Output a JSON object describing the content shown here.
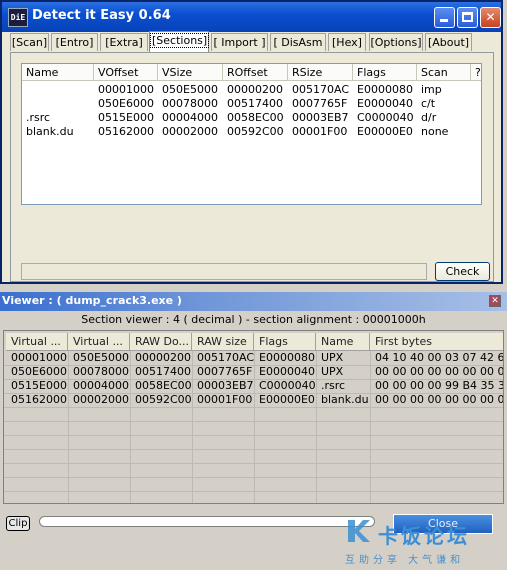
{
  "die": {
    "title": "Detect it Easy 0.64",
    "icon_label": "DiE",
    "tabs": [
      {
        "label": "[Scan]"
      },
      {
        "label": "[Entro]"
      },
      {
        "label": "[Extra]"
      },
      {
        "label": "[Sections]",
        "active": true
      },
      {
        "label": "[ Import ]"
      },
      {
        "label": "[ DisAsm ]"
      },
      {
        "label": "[Hex]"
      },
      {
        "label": "[Options]"
      },
      {
        "label": "[About]"
      }
    ],
    "sections": {
      "columns": [
        "Name",
        "VOffset",
        "VSize",
        "ROffset",
        "RSize",
        "Flags",
        "Scan",
        "?"
      ],
      "rows": [
        [
          "",
          "00001000",
          "050E5000",
          "00000200",
          "005170AC",
          "E0000080",
          "imp"
        ],
        [
          "",
          "050E6000",
          "00078000",
          "00517400",
          "0007765F",
          "E0000040",
          "c/t"
        ],
        [
          ".rsrc",
          "0515E000",
          "00004000",
          "0058EC00",
          "00003EB7",
          "C0000040",
          "d/r"
        ],
        [
          "blank.du",
          "05162000",
          "00002000",
          "00592C00",
          "00001F00",
          "E00000E0",
          "none"
        ]
      ]
    },
    "status_text": "",
    "check_label": "Check"
  },
  "viewer": {
    "title": "Viewer : ( dump_crack3.exe )",
    "info": "Section viewer : 4 ( decimal ) - section alignment : 00001000h",
    "columns": [
      "Virtual ...",
      "Virtual ...",
      "RAW Do...",
      "RAW size",
      "Flags",
      "Name",
      "First bytes"
    ],
    "rows": [
      [
        "00001000",
        "050E5000",
        "00000200",
        "005170AC",
        "E0000080",
        "UPX",
        "04 10 40 00 03 07 42 6..."
      ],
      [
        "050E6000",
        "00078000",
        "00517400",
        "0007765F",
        "E0000040",
        "UPX",
        "00 00 00 00 00 00 00 0..."
      ],
      [
        "0515E000",
        "00004000",
        "0058EC00",
        "00003EB7",
        "C0000040",
        ".rsrc",
        "00 00 00 00 99 B4 35 3..."
      ],
      [
        "05162000",
        "00002000",
        "00592C00",
        "00001F00",
        "E00000E0",
        "blank.du",
        "00 00 00 00 00 00 00 0..."
      ]
    ],
    "clip_label": "Clip",
    "close_label": "Close",
    "progress": 0
  },
  "watermark": {
    "name": "卡饭论坛",
    "slogan": "互助分享  大气谦和"
  }
}
